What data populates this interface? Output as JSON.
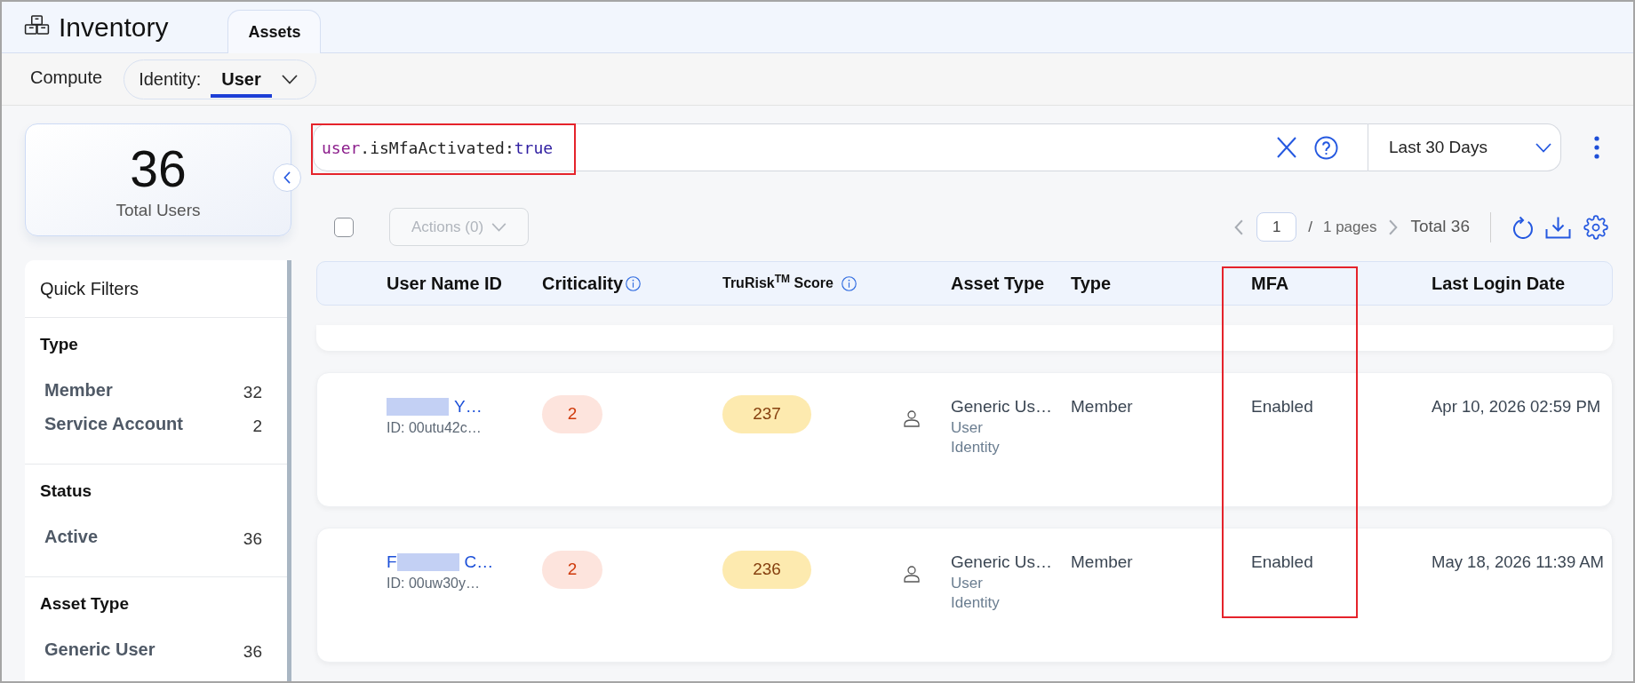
{
  "header": {
    "title": "Inventory",
    "tabs": [
      {
        "label": "Assets",
        "selected": true
      }
    ]
  },
  "subnav": {
    "items": [
      {
        "kind": "link",
        "label": "Compute",
        "selected": false
      },
      {
        "kind": "dropdown",
        "label": "Identity:",
        "value": "User",
        "selected": true
      }
    ]
  },
  "summary": {
    "count": "36",
    "label": "Total Users"
  },
  "quick_filters": {
    "title": "Quick Filters",
    "sections": [
      {
        "title": "Type",
        "items": [
          {
            "label": "Member",
            "count": "32"
          },
          {
            "label": "Service Account",
            "count": "2"
          }
        ]
      },
      {
        "title": "Status",
        "items": [
          {
            "label": "Active",
            "count": "36"
          }
        ]
      },
      {
        "title": "Asset Type",
        "items": [
          {
            "label": "Generic User",
            "count": "36"
          }
        ]
      }
    ]
  },
  "search": {
    "query": [
      {
        "kind": "field",
        "text": "user"
      },
      {
        "kind": "plain",
        "text": ".isMfaActivated:"
      },
      {
        "kind": "value",
        "text": "true"
      }
    ],
    "highlighted": true
  },
  "date_range": {
    "value": "Last 30 Days"
  },
  "toolbar": {
    "select_all": {
      "checked": false
    },
    "actions": {
      "label": "Actions (0)",
      "disabled": true
    },
    "pagination": {
      "page": "1",
      "separator": "/",
      "pages": "1 pages",
      "total": "Total 36"
    }
  },
  "table": {
    "columns": [
      {
        "label": "User Name ID"
      },
      {
        "label": "Criticality",
        "info": true
      },
      {
        "label": "TruRisk$^{TM}$ Score",
        "info": true
      },
      {
        "label": "Asset Type"
      },
      {
        "label": "Type"
      },
      {
        "label": "MFA",
        "highlighted": true
      },
      {
        "label": "Last Login Date"
      }
    ],
    "rows": [
      {
        "redacted": true,
        "name_after": "Y…",
        "id": "ID: 00utu42c…",
        "criticality": "2",
        "score": "237",
        "asset_type": "Generic Us…",
        "asset_subtype": "User",
        "asset_category": "Identity",
        "type": "Member",
        "mfa": "Enabled",
        "last_login": "Apr 10, 2026 02:59 PM"
      },
      {
        "redacted": true,
        "name_before": "F",
        "name_after": "C…",
        "id": "ID: 00uw30y…",
        "criticality": "2",
        "score": "236",
        "asset_type": "Generic Us…",
        "asset_subtype": "User",
        "asset_category": "Identity",
        "type": "Member",
        "mfa": "Enabled",
        "last_login": "May 18, 2026 11:39 AM"
      }
    ]
  }
}
